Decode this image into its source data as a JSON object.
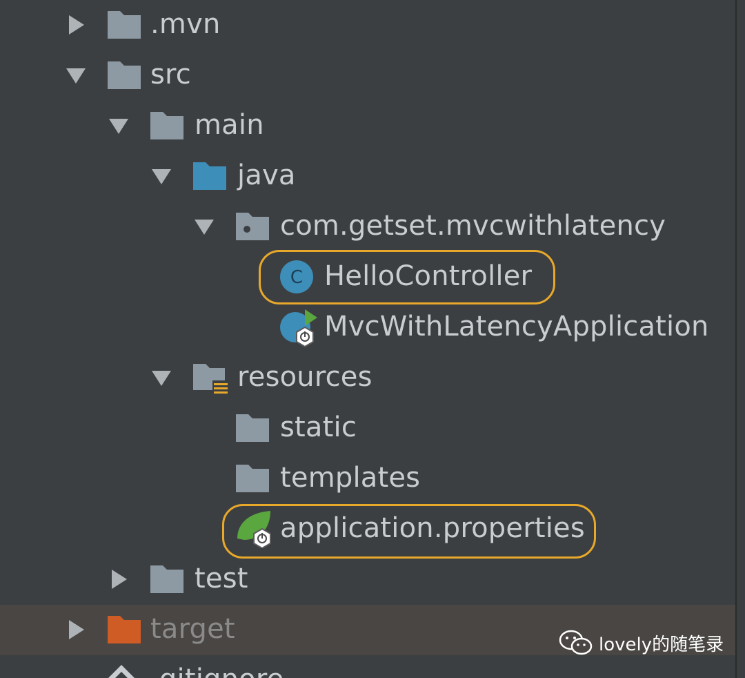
{
  "tree": [
    {
      "id": "mvn",
      "label": ".mvn",
      "state": "collapsed"
    },
    {
      "id": "src",
      "label": "src",
      "state": "expanded"
    },
    {
      "id": "main",
      "label": "main",
      "state": "expanded"
    },
    {
      "id": "java",
      "label": "java",
      "state": "expanded"
    },
    {
      "id": "package",
      "label": "com.getset.mvcwithlatency",
      "state": "expanded"
    },
    {
      "id": "hello",
      "label": "HelloController",
      "highlighted": true
    },
    {
      "id": "app",
      "label": "MvcWithLatencyApplication"
    },
    {
      "id": "resources",
      "label": "resources",
      "state": "expanded"
    },
    {
      "id": "static",
      "label": "static"
    },
    {
      "id": "templates",
      "label": "templates"
    },
    {
      "id": "props",
      "label": "application.properties",
      "highlighted": true
    },
    {
      "id": "test",
      "label": "test",
      "state": "collapsed"
    },
    {
      "id": "target",
      "label": "target",
      "state": "collapsed",
      "excluded": true
    },
    {
      "id": "gitignore",
      "label": ".gitignore"
    }
  ],
  "watermark": {
    "text": "lovely的随笔录",
    "icon": "wechat-icon"
  },
  "colors": {
    "background": "#3c3f41",
    "text": "#c9cdd1",
    "folder": "#8e9aa3",
    "source_folder": "#3d8eb9",
    "excluded_folder": "#cf5b25",
    "highlight": "#e8a92b",
    "class_icon": "#3d8eb9",
    "spring_green": "#5aa63f"
  }
}
